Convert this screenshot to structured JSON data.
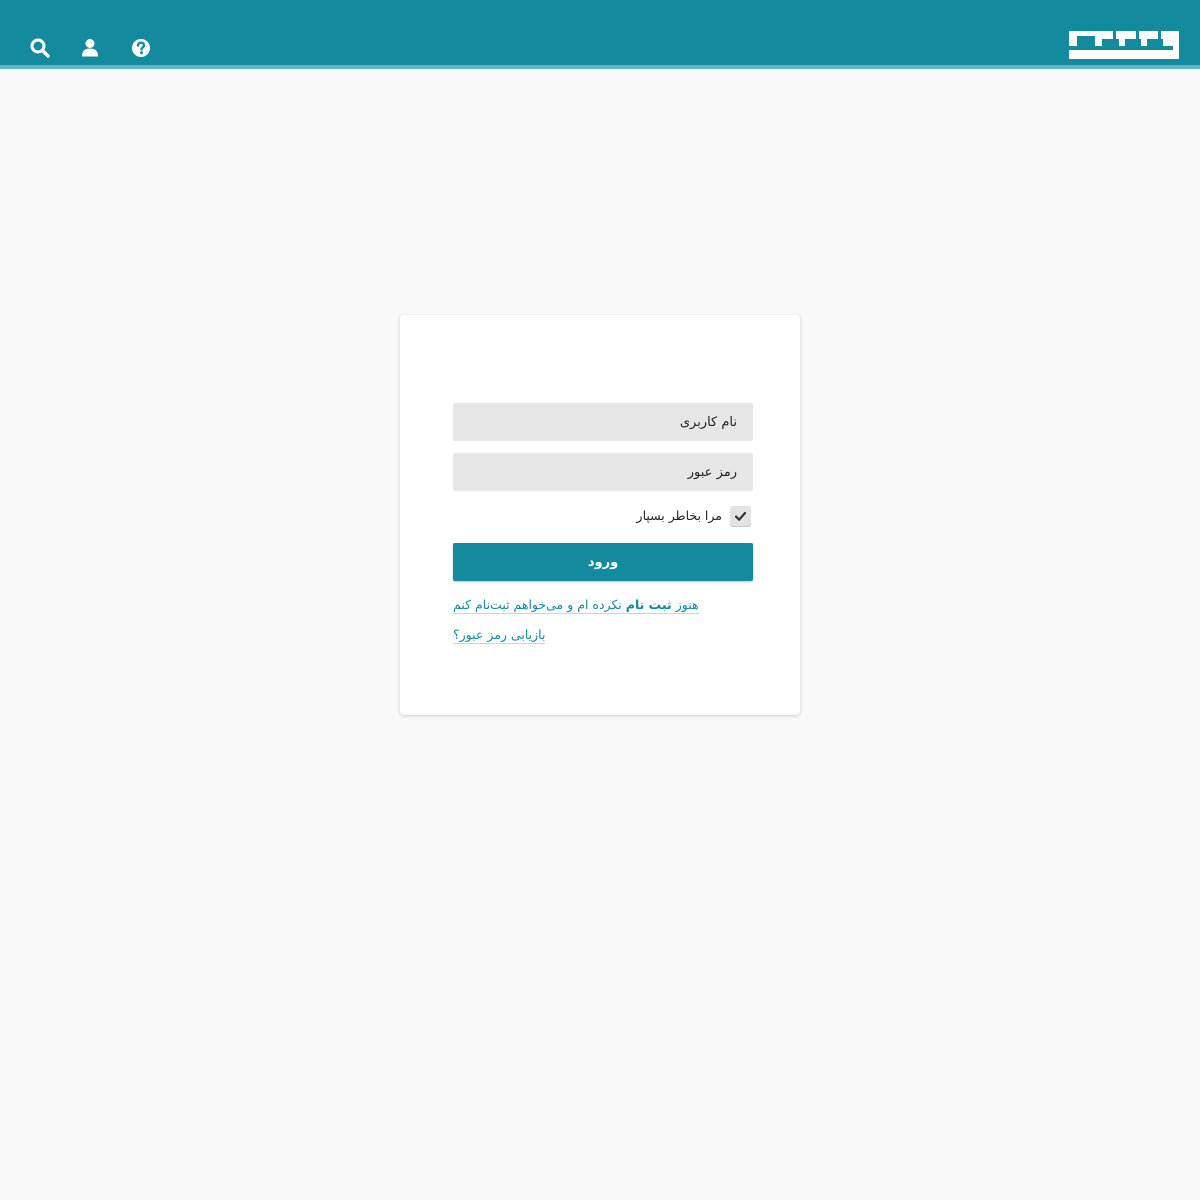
{
  "header": {
    "logo_name": "logo",
    "icons": [
      "search-icon",
      "user-icon",
      "help-icon"
    ],
    "color": "#138a9e",
    "accent_line_color": "#5cb8c6"
  },
  "login": {
    "username_placeholder": "نام کاربری",
    "password_placeholder": "رمز عبور",
    "remember_label": "مرا بخاطر بسپار",
    "remember_checked": true,
    "submit_label": "ورود",
    "signup_prefix": "هنوز",
    "signup_bold": "ثبت نام",
    "signup_suffix": "نکرده ام و می‌خواهم ثبت‌نام کنم",
    "recover_label": "بازیابی رمز عبور؟",
    "button_color": "#138a9e"
  }
}
